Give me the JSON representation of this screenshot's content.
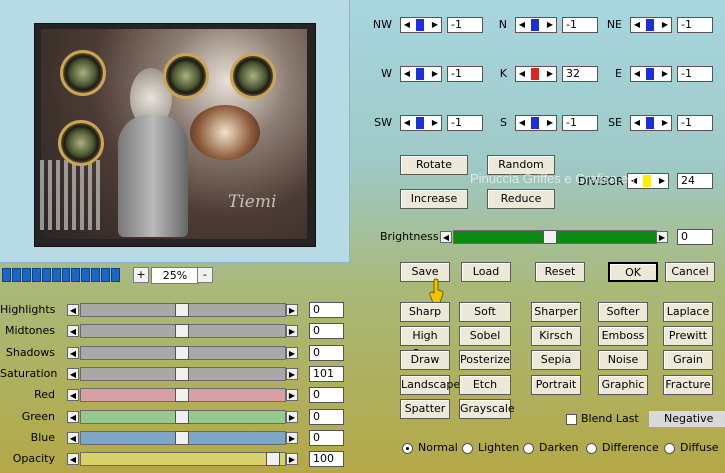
{
  "preview": {
    "signature": "Tiemi",
    "progress_segments": 12
  },
  "zoom": {
    "plus": "+",
    "value": "25%",
    "minus": "-"
  },
  "sliders": [
    {
      "label": "Highlights",
      "value": "0",
      "color": "#a8a8a8",
      "pos": 0.5
    },
    {
      "label": "Midtones",
      "value": "0",
      "color": "#a8a8a8",
      "pos": 0.5
    },
    {
      "label": "Shadows",
      "value": "0",
      "color": "#a8a8a8",
      "pos": 0.5
    },
    {
      "label": "Saturation",
      "value": "101",
      "color": "#a8a8a8",
      "pos": 0.5
    },
    {
      "label": "Red",
      "value": "0",
      "color": "#d6a0a4",
      "pos": 0.5
    },
    {
      "label": "Green",
      "value": "0",
      "color": "#96c98e",
      "pos": 0.5
    },
    {
      "label": "Blue",
      "value": "0",
      "color": "#7fa6c8",
      "pos": 0.5
    },
    {
      "label": "Opacity",
      "value": "100",
      "color": "#d9d16a",
      "pos": 0.98
    }
  ],
  "kernel": [
    {
      "label": "NW",
      "value": "-1",
      "mark": "#1a2fd8"
    },
    {
      "label": "N",
      "value": "-1",
      "mark": "#1a2fd8"
    },
    {
      "label": "NE",
      "value": "-1",
      "mark": "#1a2fd8"
    },
    {
      "label": "W",
      "value": "-1",
      "mark": "#1a2fd8"
    },
    {
      "label": "K",
      "value": "32",
      "mark": "#e02222"
    },
    {
      "label": "E",
      "value": "-1",
      "mark": "#1a2fd8"
    },
    {
      "label": "SW",
      "value": "-1",
      "mark": "#1a2fd8"
    },
    {
      "label": "S",
      "value": "-1",
      "mark": "#1a2fd8"
    },
    {
      "label": "SE",
      "value": "-1",
      "mark": "#1a2fd8"
    }
  ],
  "controls": {
    "rotate": "Rotate",
    "random": "Random",
    "increase": "Increase",
    "reduce": "Reduce",
    "divisor_label": "DIVISOR",
    "divisor_value": "24",
    "divisor_mark": "#ffee00",
    "brightness_label": "Brightness",
    "brightness_value": "0",
    "brightness_color": "#0a8a12"
  },
  "actions": {
    "save": "Save",
    "load": "Load",
    "reset": "Reset",
    "ok": "OK",
    "cancel": "Cancel"
  },
  "presets": [
    "Sharp",
    "Soft",
    "Sharper",
    "Softer",
    "Laplace",
    "High Pass",
    "Sobel",
    "Kirsch",
    "Emboss",
    "Prewitt",
    "Draw",
    "Posterize",
    "Sepia",
    "Noise",
    "Grain",
    "Landscape",
    "Etch",
    "Portrait",
    "Graphic",
    "Fracture",
    "Spatter",
    "Grayscale"
  ],
  "options": {
    "blend_last": "Blend Last",
    "negative": "Negative"
  },
  "blend_modes": [
    "Normal",
    "Lighten",
    "Darken",
    "Difference",
    "Diffuse"
  ],
  "watermark": "Pinuccia Griffes e Grafica.eu"
}
